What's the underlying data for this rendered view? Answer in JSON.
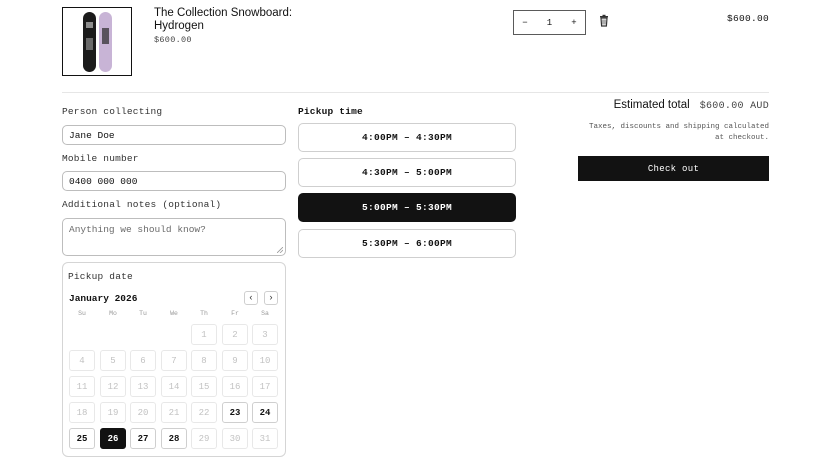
{
  "product": {
    "title": "The Collection Snowboard: Hydrogen",
    "price": "$600.00",
    "image": "snowboard-image",
    "quantity": "1",
    "decrease_icon": "minus-icon",
    "increase_icon": "plus-icon",
    "remove_icon": "trash-icon",
    "line_total": "$600.00"
  },
  "form": {
    "person_label": "Person collecting",
    "person_value": "Jane Doe",
    "mobile_label": "Mobile number",
    "mobile_value": "0400 000 000",
    "notes_label": "Additional notes (optional)",
    "notes_placeholder": "Anything we should know?"
  },
  "calendar": {
    "label": "Pickup date",
    "month": "January 2026",
    "prev": "‹",
    "next": "›",
    "weekdays": [
      "Su",
      "Mo",
      "Tu",
      "We",
      "Th",
      "Fr",
      "Sa"
    ],
    "leading_blanks": 4,
    "days_in_month": 31,
    "available_days": [
      23,
      24,
      25,
      27,
      28
    ],
    "selected_day": 26
  },
  "pickup": {
    "label": "Pickup time",
    "slots": [
      "4:00PM – 4:30PM",
      "4:30PM – 5:00PM",
      "5:00PM – 5:30PM",
      "5:30PM – 6:00PM"
    ],
    "selected_index": 2
  },
  "summary": {
    "estimated_label": "Estimated total",
    "estimated_value": "$600.00 AUD",
    "tax_note": "Taxes, discounts and shipping calculated at checkout.",
    "checkout_label": "Check out"
  },
  "colors": {
    "primary": "#121212",
    "border": "#cfcfcf",
    "muted": "#c2c2c2"
  }
}
